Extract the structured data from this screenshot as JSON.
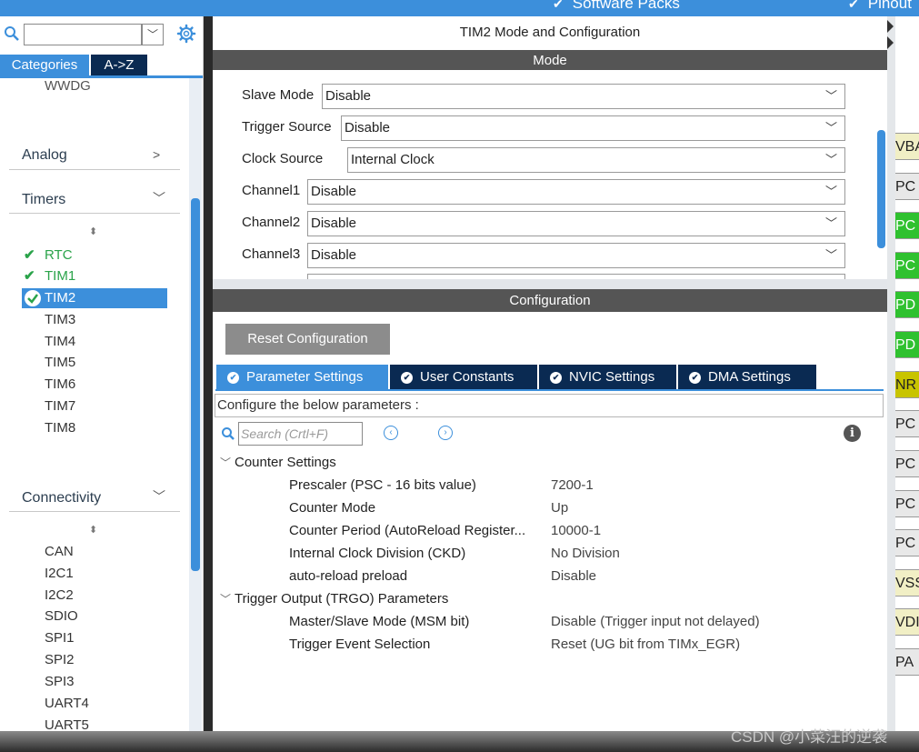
{
  "topbar": {
    "software_packs": "Software Packs",
    "pinout": "Pinout"
  },
  "left": {
    "search": {
      "value": "",
      "placeholder": ""
    },
    "tabs": {
      "categories": "Categories",
      "atoz": "A->Z"
    },
    "partial_item": "WWDG",
    "analog": "Analog",
    "timers": "Timers",
    "timer_items": [
      "RTC",
      "TIM1",
      "TIM2",
      "TIM3",
      "TIM4",
      "TIM5",
      "TIM6",
      "TIM7",
      "TIM8"
    ],
    "connectivity": "Connectivity",
    "connectivity_items": [
      "CAN",
      "I2C1",
      "I2C2",
      "SDIO",
      "SPI1",
      "SPI2",
      "SPI3",
      "UART4",
      "UART5"
    ]
  },
  "center": {
    "title": "TIM2 Mode and Configuration",
    "mode_header": "Mode",
    "mode_rows": [
      {
        "label": "Slave Mode",
        "value": "Disable"
      },
      {
        "label": "Trigger Source",
        "value": "Disable"
      },
      {
        "label": "Clock Source",
        "value": "Internal Clock"
      },
      {
        "label": "Channel1",
        "value": "Disable"
      },
      {
        "label": "Channel2",
        "value": "Disable"
      },
      {
        "label": "Channel3",
        "value": "Disable"
      }
    ],
    "config_header": "Configuration",
    "reset_button": "Reset Configuration",
    "tabs": [
      "Parameter Settings",
      "User Constants",
      "NVIC Settings",
      "DMA Settings"
    ],
    "configure_text": "Configure the below parameters :",
    "search_placeholder": "Search (Crtl+F)",
    "groups": [
      {
        "title": "Counter Settings",
        "params": [
          {
            "name": "Prescaler (PSC - 16 bits value)",
            "value": "7200-1"
          },
          {
            "name": "Counter Mode",
            "value": "Up"
          },
          {
            "name": "Counter Period (AutoReload Register...",
            "value": "10000-1"
          },
          {
            "name": "Internal Clock Division (CKD)",
            "value": "No Division"
          },
          {
            "name": "auto-reload preload",
            "value": "Disable"
          }
        ]
      },
      {
        "title": "Trigger Output (TRGO) Parameters",
        "params": [
          {
            "name": "Master/Slave Mode (MSM bit)",
            "value": "Disable (Trigger input not delayed)"
          },
          {
            "name": "Trigger Event Selection",
            "value": "Reset (UG bit from TIMx_EGR)"
          }
        ]
      }
    ]
  },
  "right": {
    "pins": [
      "VBA",
      "PC",
      "PC",
      "PC",
      "PD",
      "PD",
      "NR",
      "PC",
      "PC",
      "PC",
      "PC",
      "VSS",
      "VDI",
      "PA"
    ]
  },
  "watermark": "CSDN @小菜汪的逆袭",
  "colors": {
    "accent": "#3c8fdb",
    "dark_tab": "#0a2a52",
    "pin_green": "#2fc12f",
    "pin_olive": "#c8c400",
    "check_green": "#2aa34a"
  }
}
